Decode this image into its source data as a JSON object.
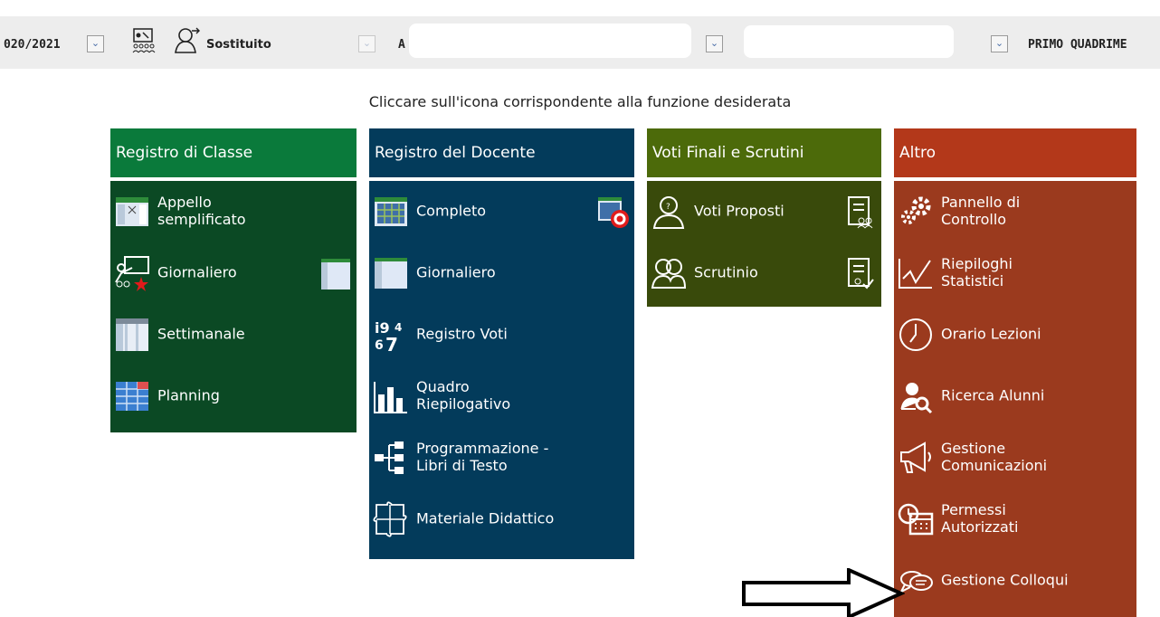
{
  "topbar": {
    "year": "020/2021",
    "substitute_label": "Sostituito",
    "class_prefix": "A",
    "period": "PRIMO QUADRIME"
  },
  "instruction": "Cliccare sull'icona corrispondente alla funzione desiderata",
  "columns": {
    "classe": {
      "title": "Registro di Classe",
      "items": [
        {
          "label": "Appello\nsemplificato"
        },
        {
          "label": "Giornaliero"
        },
        {
          "label": "Settimanale"
        },
        {
          "label": "Planning"
        }
      ]
    },
    "docente": {
      "title": "Registro del Docente",
      "items": [
        {
          "label": "Completo"
        },
        {
          "label": "Giornaliero"
        },
        {
          "label": "Registro Voti"
        },
        {
          "label": "Quadro\nRiepilogativo"
        },
        {
          "label": "Programmazione -\nLibri di Testo"
        },
        {
          "label": "Materiale Didattico"
        }
      ]
    },
    "voti": {
      "title": "Voti Finali e Scrutini",
      "items": [
        {
          "label": "Voti Proposti"
        },
        {
          "label": "Scrutinio"
        }
      ]
    },
    "altro": {
      "title": "Altro",
      "items": [
        {
          "label": "Pannello di\nControllo"
        },
        {
          "label": "Riepiloghi\nStatistici"
        },
        {
          "label": "Orario Lezioni"
        },
        {
          "label": "Ricerca Alunni"
        },
        {
          "label": "Gestione\nComunicazioni"
        },
        {
          "label": "Permessi\nAutorizzati"
        },
        {
          "label": "Gestione Colloqui"
        }
      ]
    }
  },
  "colors": {
    "classe_head": "#0a7a3b",
    "classe_body": "#0b4924",
    "docente": "#033b5b",
    "voti_head": "#4c6a0a",
    "voti_body": "#394a0b",
    "altro_head": "#b3381a",
    "altro_body": "#9b3a1e"
  },
  "icons": {
    "classe": [
      "roster-icon",
      "teacher-board-icon",
      "weekly-grid-icon",
      "planning-grid-icon"
    ],
    "docente": [
      "calendar-grid-icon",
      "daily-sheet-icon",
      "grades-numbers-icon",
      "bar-chart-icon",
      "tree-structure-icon",
      "puzzle-icon"
    ],
    "voti": [
      "person-icon",
      "people-icon"
    ],
    "altro": [
      "gears-icon",
      "line-chart-icon",
      "clock-icon",
      "search-user-icon",
      "megaphone-icon",
      "calendar-clock-icon",
      "chat-bubbles-icon"
    ]
  }
}
